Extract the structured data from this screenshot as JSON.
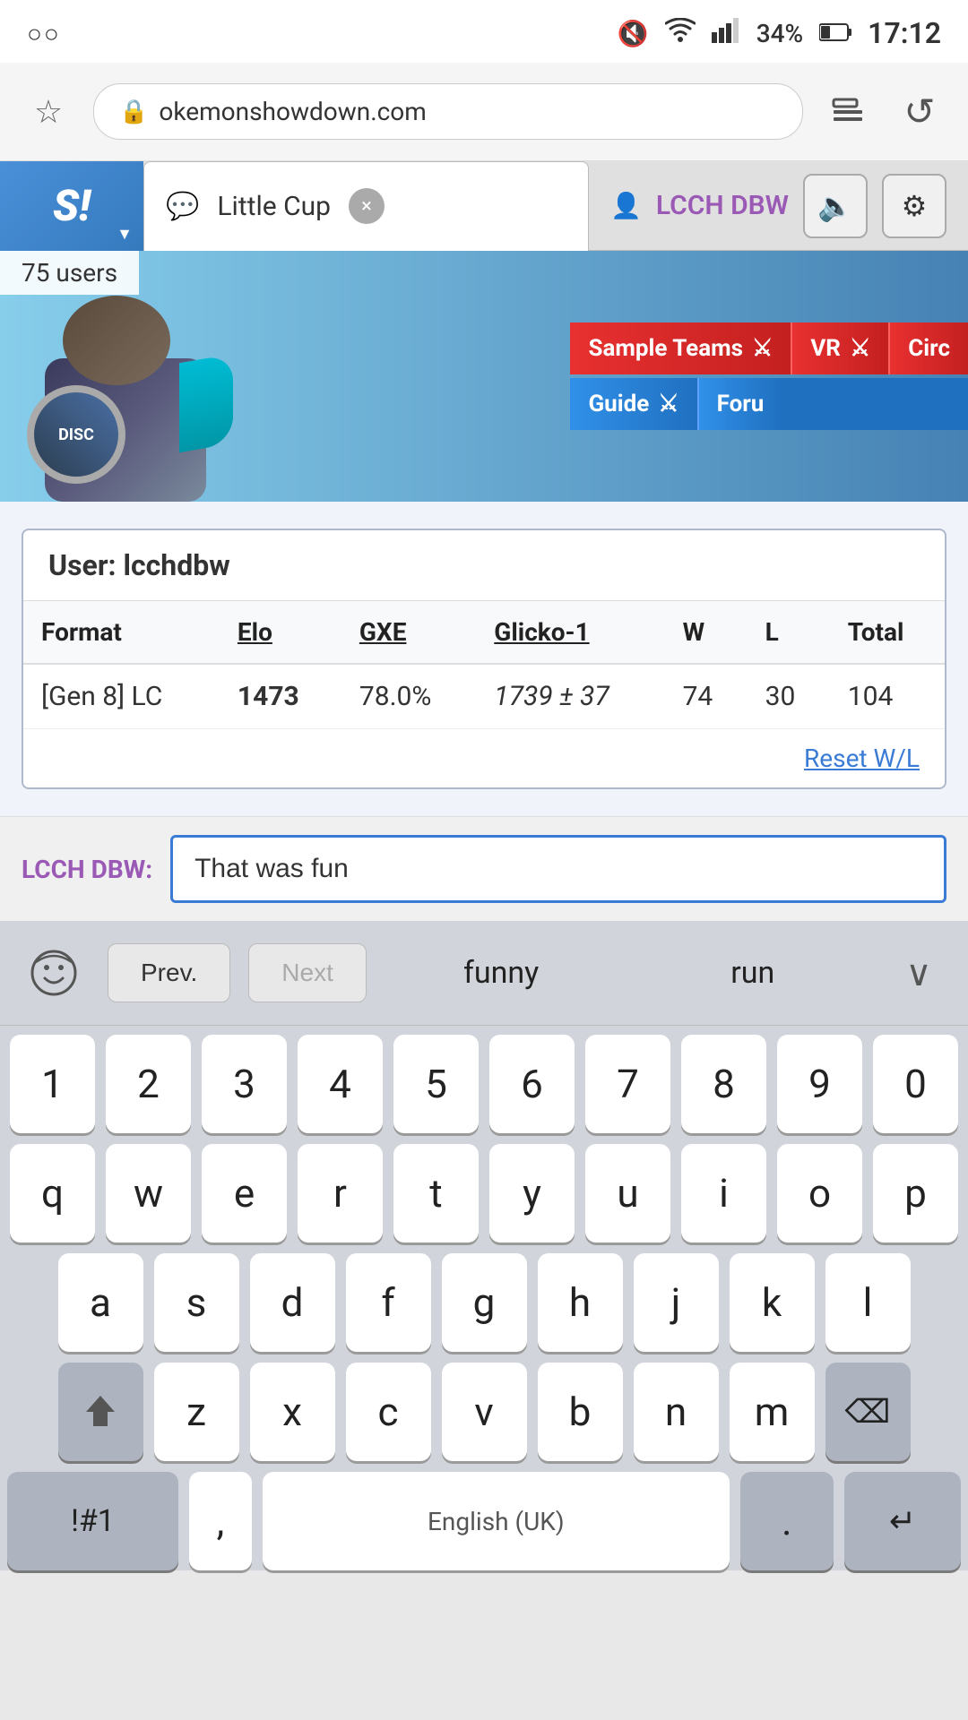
{
  "statusBar": {
    "leftIcon": "○○",
    "muteIcon": "🔇",
    "wifiIcon": "wifi",
    "signalIcon": "signal",
    "battery": "34%",
    "batteryIcon": "🔋",
    "time": "17:12"
  },
  "browserBar": {
    "bookmarkIcon": "☆",
    "lockIcon": "🔒",
    "url": "okemonshowdown.com",
    "tabsIcon": "tabs",
    "refreshIcon": "↺"
  },
  "tabs": {
    "logoText": "S!",
    "tab1": {
      "label": "Little Cup",
      "closeBtn": "×"
    },
    "user": {
      "icon": "👤",
      "name": "LCCH DBW"
    },
    "muteBtn": "🔈",
    "settingsBtn": "⚙"
  },
  "banner": {
    "users": "75 users",
    "navItems": [
      "Sample Teams",
      "VR",
      "Circ"
    ],
    "navItems2": [
      "Guide",
      "Foru"
    ]
  },
  "stats": {
    "userLabel": "User:",
    "username": "lcchdbw",
    "columns": [
      "Format",
      "Elo",
      "GXE",
      "Glicko-1",
      "W",
      "L",
      "Total"
    ],
    "rows": [
      {
        "format": "[Gen 8] LC",
        "elo": "1473",
        "gxe": "78.0%",
        "glicko": "1739 ± 37",
        "w": "74",
        "l": "30",
        "total": "104"
      }
    ],
    "resetLink": "Reset W/L"
  },
  "chatInput": {
    "usernameLabel": "LCCH DBW:",
    "inputValue": "That was fun",
    "inputPlaceholder": ""
  },
  "keyboard": {
    "toolbar": {
      "emojiIcon": "↺",
      "prevLabel": "Prev.",
      "nextLabel": "Next",
      "suggestion1": "funny",
      "suggestion2": "run",
      "expandIcon": "∨"
    },
    "rows": {
      "numbers": [
        "1",
        "2",
        "3",
        "4",
        "5",
        "6",
        "7",
        "8",
        "9",
        "0"
      ],
      "row1": [
        "q",
        "w",
        "e",
        "r",
        "t",
        "y",
        "u",
        "i",
        "o",
        "p"
      ],
      "row2": [
        "a",
        "s",
        "d",
        "f",
        "g",
        "h",
        "j",
        "k",
        "l"
      ],
      "row3": [
        "z",
        "x",
        "c",
        "v",
        "b",
        "n",
        "m"
      ],
      "bottomLeft": "!#1",
      "comma": ",",
      "spaceLabel": "English (UK)",
      "period": ".",
      "enterIcon": "↵"
    }
  }
}
